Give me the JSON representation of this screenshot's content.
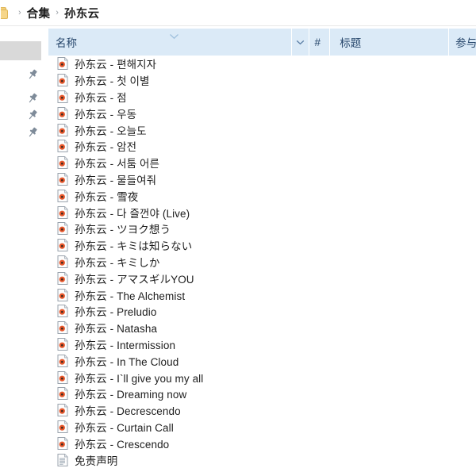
{
  "breadcrumb": {
    "folder_icon": "folder-icon",
    "separator": "›",
    "items": [
      {
        "label": "合集"
      },
      {
        "label": "孙东云"
      }
    ]
  },
  "sidebar": {
    "pins": [
      {
        "icon": "pin-icon"
      },
      {
        "icon": "pin-icon"
      },
      {
        "icon": "pin-icon"
      },
      {
        "icon": "pin-icon"
      }
    ]
  },
  "table": {
    "columns": [
      {
        "key": "name",
        "label": "名称"
      },
      {
        "key": "num",
        "label": "#"
      },
      {
        "key": "title",
        "label": "标题"
      },
      {
        "key": "part",
        "label": "参与"
      }
    ],
    "sort_icon": "chevron-down-icon",
    "rows": [
      {
        "icon": "media-file-icon",
        "label": "孙东云 - 편해지자"
      },
      {
        "icon": "media-file-icon",
        "label": "孙东云 - 첫 이별"
      },
      {
        "icon": "media-file-icon",
        "label": "孙东云 - 점"
      },
      {
        "icon": "media-file-icon",
        "label": "孙东云 - 우동"
      },
      {
        "icon": "media-file-icon",
        "label": "孙东云 - 오늘도"
      },
      {
        "icon": "media-file-icon",
        "label": "孙东云 - 암전"
      },
      {
        "icon": "media-file-icon",
        "label": "孙东云 - 서툼 어른"
      },
      {
        "icon": "media-file-icon",
        "label": "孙东云 - 물들여줘"
      },
      {
        "icon": "media-file-icon",
        "label": "孙东云 - 雪夜"
      },
      {
        "icon": "media-file-icon",
        "label": "孙东云 - 다 즐껀야 (Live)"
      },
      {
        "icon": "media-file-icon",
        "label": "孙东云 - ツヨク想う"
      },
      {
        "icon": "media-file-icon",
        "label": "孙东云 - キミは知らない"
      },
      {
        "icon": "media-file-icon",
        "label": "孙东云 - キミしか"
      },
      {
        "icon": "media-file-icon",
        "label": "孙东云 - アマスギルYOU"
      },
      {
        "icon": "media-file-icon",
        "label": "孙东云 - The Alchemist"
      },
      {
        "icon": "media-file-icon",
        "label": "孙东云 - Preludio"
      },
      {
        "icon": "media-file-icon",
        "label": "孙东云 - Natasha"
      },
      {
        "icon": "media-file-icon",
        "label": "孙东云 - Intermission"
      },
      {
        "icon": "media-file-icon",
        "label": "孙东云 - In The Cloud"
      },
      {
        "icon": "media-file-icon",
        "label": "孙东云 - I`ll give you my all"
      },
      {
        "icon": "media-file-icon",
        "label": "孙东云 - Dreaming now"
      },
      {
        "icon": "media-file-icon",
        "label": "孙东云 - Decrescendo"
      },
      {
        "icon": "media-file-icon",
        "label": "孙东云 - Curtain Call"
      },
      {
        "icon": "media-file-icon",
        "label": "孙东云 - Crescendo"
      },
      {
        "icon": "text-file-icon",
        "label": "免责声明"
      }
    ]
  },
  "colors": {
    "header_bg": "#dbeaf7",
    "header_text": "#26466b",
    "row_text": "#1d1d1d",
    "rail_block": "#d9d9d9",
    "folder": "#f6d68a",
    "media_disc": "#e8572b"
  }
}
